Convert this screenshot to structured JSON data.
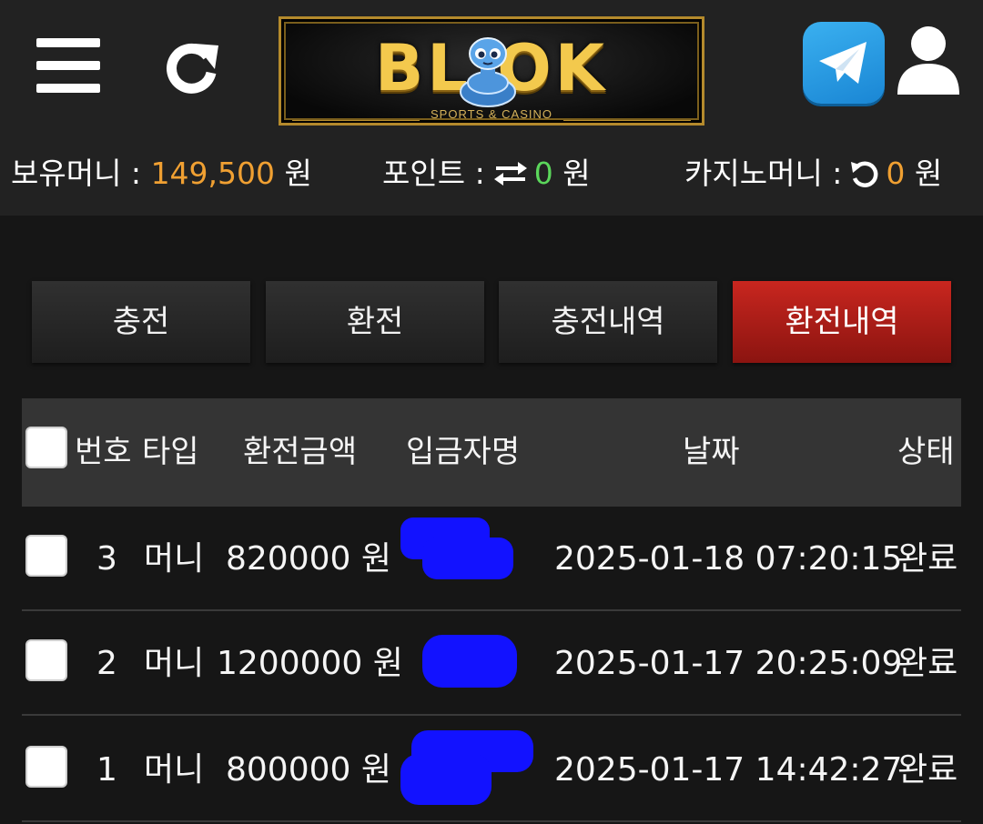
{
  "header": {
    "logo_text": "BL OK",
    "logo_subtitle": "SPORTS & CASINO"
  },
  "balance": {
    "money_label": "보유머니 :",
    "money_value": "149,500",
    "money_unit": "원",
    "point_label": "포인트 :",
    "point_value": "0",
    "point_unit": "원",
    "casino_label": "카지노머니 :",
    "casino_value": "0",
    "casino_unit": "원"
  },
  "tabs": [
    {
      "label": "충전",
      "active": false
    },
    {
      "label": "환전",
      "active": false
    },
    {
      "label": "충전내역",
      "active": false
    },
    {
      "label": "환전내역",
      "active": true
    }
  ],
  "table": {
    "columns": [
      "번호",
      "타입",
      "환전금액",
      "입금자명",
      "날짜",
      "상태"
    ],
    "rows": [
      {
        "no": "3",
        "type": "머니",
        "amount": "820000 원",
        "date": "2025-01-18 07:20:15",
        "status": "완료"
      },
      {
        "no": "2",
        "type": "머니",
        "amount": "1200000 원",
        "date": "2025-01-17 20:25:09",
        "status": "완료"
      },
      {
        "no": "1",
        "type": "머니",
        "amount": "800000 원",
        "date": "2025-01-17 14:42:27",
        "status": "완료"
      }
    ]
  },
  "colors": {
    "accent_active_tab": "#b01e18",
    "money_value": "#f0a032",
    "point_value": "#5bd75b",
    "redaction": "#1212ff"
  }
}
